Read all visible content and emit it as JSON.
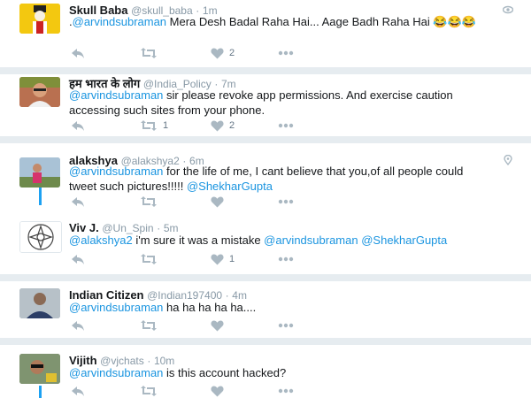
{
  "tweets": [
    {
      "name": "Skull Baba",
      "handle": "@skull_baba",
      "time": "1m",
      "prefix": ".",
      "mention": "@arvindsubraman",
      "text": " Mera Desh Badal Raha Hai... Aage Badh Raha Hai 😂😂😂",
      "retweets": "",
      "likes": "2"
    },
    {
      "name": "हम भारत के लोग",
      "handle": "@India_Policy",
      "time": "7m",
      "mention": "@arvindsubraman",
      "text_line1": " sir please revoke app permissions. And exercise caution",
      "text_line2": "accessing such sites from your phone.",
      "retweets": "1",
      "likes": "2"
    },
    {
      "name": "alakshya",
      "handle": "@alakshya2",
      "time": "6m",
      "mention": "@arvindsubraman",
      "text_line1": " for the life of me, I cant believe that you,of all people could",
      "text_line2": "tweet such pictures!!!!! ",
      "mention2": "@ShekharGupta",
      "retweets": "",
      "likes": ""
    },
    {
      "name": "Viv J.",
      "handle": "@Un_Spin",
      "time": "5m",
      "mention": "@alakshya2",
      "text": " i'm sure it was a mistake ",
      "mention2": "@arvindsubraman",
      "mention3": "@ShekharGupta",
      "retweets": "",
      "likes": "1"
    },
    {
      "name": "Indian Citizen",
      "handle": "@Indian197400",
      "time": "4m",
      "mention": "@arvindsubraman",
      "text": " ha ha ha ha ha....",
      "retweets": "",
      "likes": ""
    },
    {
      "name": "Vijith",
      "handle": "@vjchats",
      "time": "10m",
      "mention": "@arvindsubraman",
      "text": " is this account hacked?",
      "retweets": "",
      "likes": ""
    }
  ],
  "separator": "·",
  "icons": {
    "reply": "reply-icon",
    "retweet": "retweet-icon",
    "like": "heart-icon",
    "more": "more-dots-icon",
    "view": "eye-icon",
    "location": "location-pin-icon"
  },
  "colors": {
    "link": "#1b95e0",
    "muted": "#8899a6",
    "icon": "#aab8c2",
    "thread": "#1da1f2",
    "gap": "#e6ecf0"
  }
}
